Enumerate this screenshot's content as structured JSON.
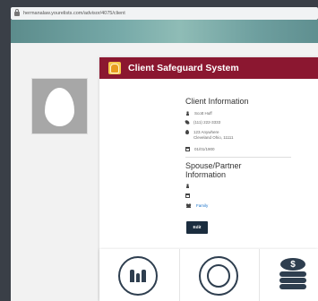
{
  "browser": {
    "url": "hermanalaw.yourelists.com/advisor/4075/client"
  },
  "card": {
    "title": "Client Safeguard System"
  },
  "client": {
    "section_title": "Client Information",
    "name": "Scott Huff",
    "phone": "(111) 222-3333",
    "address_line1": "123 Anywhere",
    "address_line2": "Cleveland Ohio, 11111",
    "dob": "01/01/1900"
  },
  "spouse": {
    "section_title_line1": "Spouse/Partner",
    "section_title_line2": "Information",
    "family_link": "Family"
  },
  "actions": {
    "edit_label": "Edit"
  },
  "icons": {
    "family_tile": "family-house-icon",
    "people_tile": "people-circle-icon",
    "money_tile": "coin-stack-icon",
    "coin_symbol": "$"
  },
  "colors": {
    "header": "#8b1730",
    "edit_button": "#1b2d3f",
    "link": "#1b73c9"
  }
}
